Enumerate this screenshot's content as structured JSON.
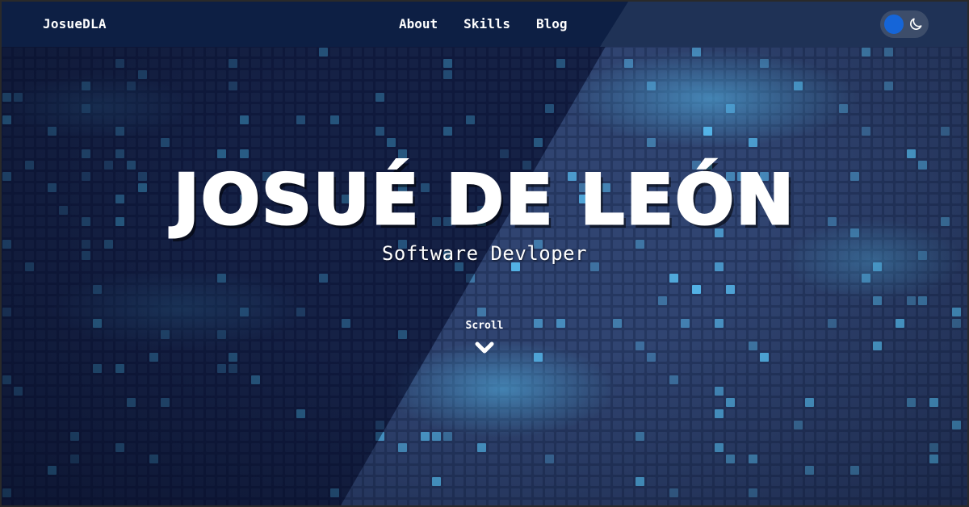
{
  "nav": {
    "brand": "JosueDLA",
    "links": [
      {
        "label": "About"
      },
      {
        "label": "Skills"
      },
      {
        "label": "Blog"
      }
    ],
    "theme_toggle": {
      "state": "light-off",
      "icon": "moon-icon"
    }
  },
  "hero": {
    "name": "JOSUÉ DE LEÓN",
    "subtitle": "Software Devloper",
    "scroll_label": "Scroll",
    "scroll_icon": "chevron-down-icon"
  },
  "colors": {
    "nav_dark": "#0d1f44",
    "nav_light": "#1f3256",
    "toggle_knob": "#1565d8",
    "cell_glow": "#4fc3f7"
  }
}
